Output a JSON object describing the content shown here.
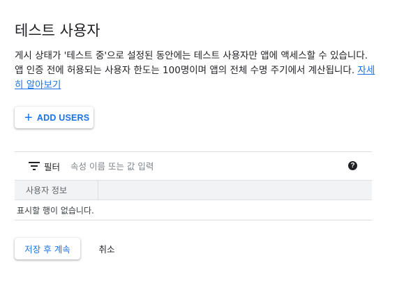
{
  "page": {
    "title": "테스트 사용자",
    "description": "게시 상태가 '테스트 중'으로 설정된 동안에는 테스트 사용자만 앱에 액세스할 수 있습니다. 앱 인증 전에 허용되는 사용자 한도는 100명이며 앱의 전체 수명 주기에서 계산됩니다.",
    "learn_more_link": "자세히 알아보기"
  },
  "add_users_button": {
    "label": "ADD USERS",
    "icon": "plus-icon"
  },
  "filter": {
    "label": "필터",
    "placeholder": "속성 이름 또는 값 입력",
    "icon": "filter-icon",
    "help_icon": "help-icon"
  },
  "table": {
    "columns": [
      "사용자 정보"
    ],
    "empty_message": "표시할 행이 없습니다."
  },
  "actions": {
    "save_continue": "저장 후 계속",
    "cancel": "취소"
  },
  "colors": {
    "accent": "#1a73e8",
    "text": "#202124",
    "divider": "#dadce0",
    "header_bg": "#f1f3f4"
  }
}
